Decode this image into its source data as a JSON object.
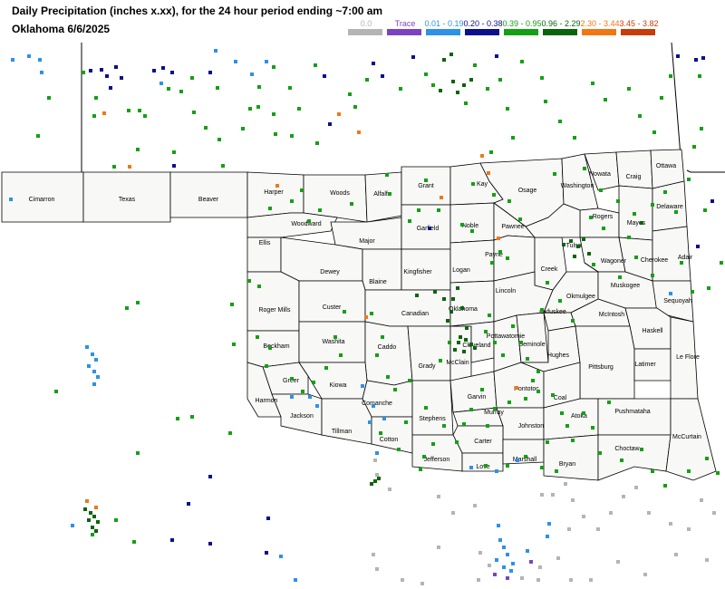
{
  "header": {
    "title": "Daily Precipitation (inches  x.xx),  for the 24 hour period ending ~7:00 am",
    "subtitle": "Oklahoma 6/6/2025"
  },
  "legend": [
    {
      "label": "0.0",
      "color": "#b4b4b4"
    },
    {
      "label": "Trace",
      "color": "#7b43c2"
    },
    {
      "label": "0.01 - 0.19",
      "color": "#2d91e8"
    },
    {
      "label": "0.20 - 0.38",
      "color": "#0a0f8c"
    },
    {
      "label": "0.39 - 0.95",
      "color": "#14a014"
    },
    {
      "label": "0.96 - 2.29",
      "color": "#0b640b"
    },
    {
      "label": "2.30 - 3.44",
      "color": "#f07814"
    },
    {
      "label": "3.45 - 3.82",
      "color": "#c83c0a"
    }
  ],
  "counties": [
    "Cimarron",
    "Texas",
    "Beaver",
    "Harper",
    "Woods",
    "Alfalfa",
    "Grant",
    "Kay",
    "Osage",
    "Washington",
    "Nowata",
    "Craig",
    "Ottawa",
    "Woodward",
    "Major",
    "Garfield",
    "Noble",
    "Pawnee",
    "Rogers",
    "Mayes",
    "Delaware",
    "Ellis",
    "Dewey",
    "Blaine",
    "Kingfisher",
    "Logan",
    "Payne",
    "Creek",
    "Tulsa",
    "Wagoner",
    "Cherokee",
    "Adair",
    "Roger Mills",
    "Custer",
    "Canadian",
    "Oklahoma",
    "Lincoln",
    "Okmulgee",
    "Muskogee",
    "Sequoyah",
    "Beckham",
    "Washita",
    "Caddo",
    "Grady",
    "McClain",
    "Cleveland",
    "Pottawatomie",
    "Seminole",
    "Okfuskee",
    "McIntosh",
    "Haskell",
    "Greer",
    "Kiowa",
    "Harmon",
    "Jackson",
    "Comanche",
    "Tillman",
    "Cotton",
    "Stephens",
    "Garvin",
    "Murray",
    "Pontotoc",
    "Hughes",
    "Pittsburg",
    "Latimer",
    "Le Flore",
    "Coal",
    "Johnston",
    "Atoka",
    "Pushmataha",
    "Carter",
    "Love",
    "Marshall",
    "Jefferson",
    "Bryan",
    "Choctaw",
    "McCurtain"
  ]
}
